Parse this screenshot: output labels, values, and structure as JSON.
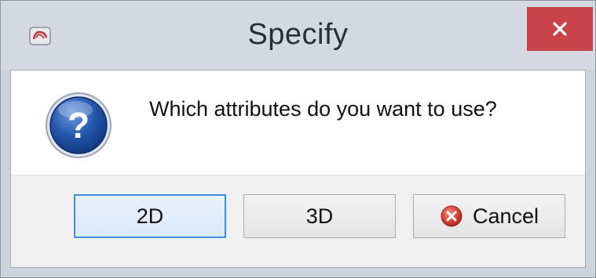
{
  "window": {
    "title": "Specify"
  },
  "dialog": {
    "message": "Which attributes do you want to use?",
    "icon": "question-icon"
  },
  "buttons": {
    "two_d": "2D",
    "three_d": "3D",
    "cancel": "Cancel"
  },
  "colors": {
    "close_button": "#c9444a",
    "default_button_border": "#3c8fdc",
    "question_icon_blue": "#1c4fa3",
    "cancel_icon_red": "#d9463b"
  },
  "close_glyph": "✕"
}
